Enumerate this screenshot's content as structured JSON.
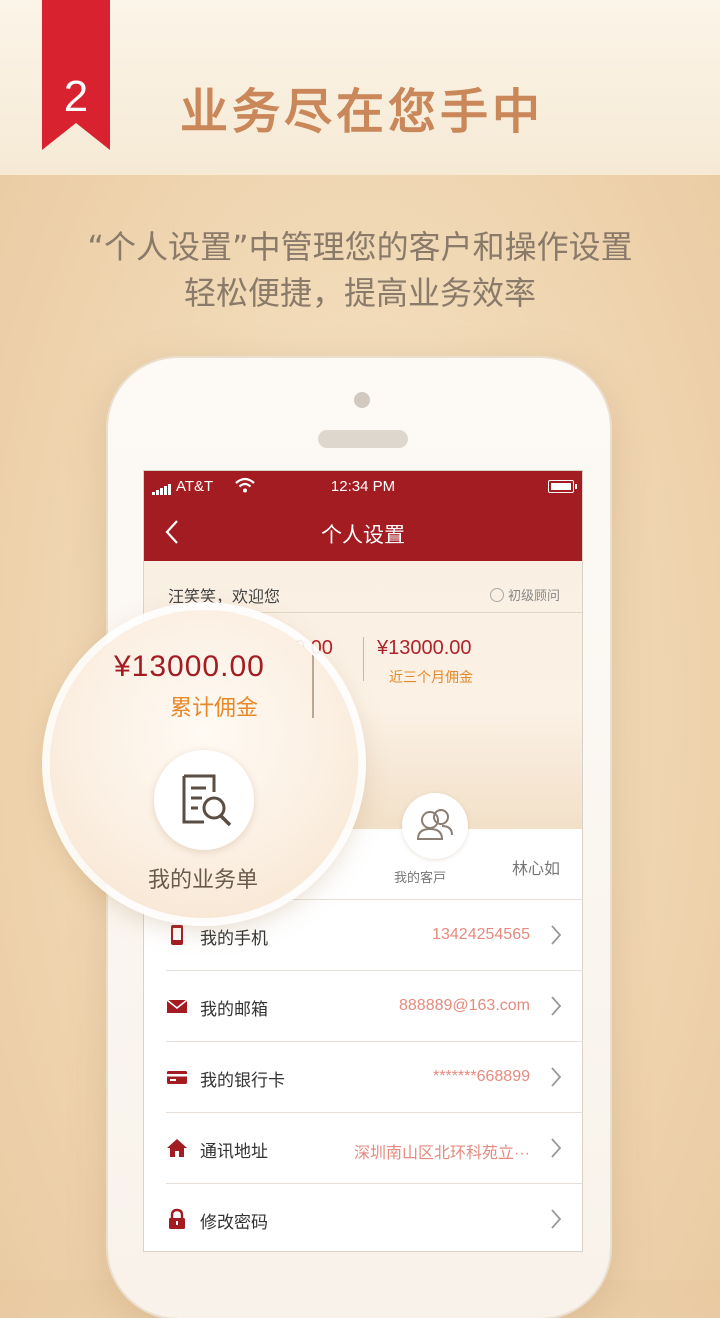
{
  "banner": {
    "number": "2",
    "headline": "业务尽在您手中",
    "subline1": "“个人设置”中管理您的客户和操作设置",
    "subline2": "轻松便捷，提高业务效率"
  },
  "status_bar": {
    "carrier": "AT&T",
    "time": "12:34 PM"
  },
  "nav": {
    "title": "个人设置"
  },
  "profile": {
    "welcome": "汪笑笑，欢迎您",
    "level": "初级顾问",
    "left_amount_partial": "0.00",
    "right_amount": "¥13000.00",
    "right_label": "近三个月佣金",
    "client_button_label": "我的客戸"
  },
  "magnifier": {
    "amount": "¥13000.00",
    "label": "累计佣金",
    "button_label": "我的业务单"
  },
  "list": [
    {
      "label": "",
      "value": "林心如",
      "icon": "none",
      "chevron": false
    },
    {
      "label": "我的手机",
      "value": "13424254565",
      "icon": "phone-icon",
      "chevron": true
    },
    {
      "label": "我的邮箱",
      "value": "888889@163.com",
      "icon": "mail-icon",
      "chevron": true
    },
    {
      "label": "我的银行卡",
      "value": "*******668899",
      "icon": "card-icon",
      "chevron": true
    },
    {
      "label": "通讯地址",
      "value": "深圳南山区北环科苑立···",
      "icon": "home-icon",
      "chevron": true
    },
    {
      "label": "修改密码",
      "value": "",
      "icon": "lock-icon",
      "chevron": true
    }
  ],
  "colors": {
    "brand_red": "#a21c22",
    "ribbon_red": "#d8222f",
    "accent_orange": "#e7892a",
    "value_pink": "#e58a7e",
    "headline_tan": "#c9875a"
  }
}
